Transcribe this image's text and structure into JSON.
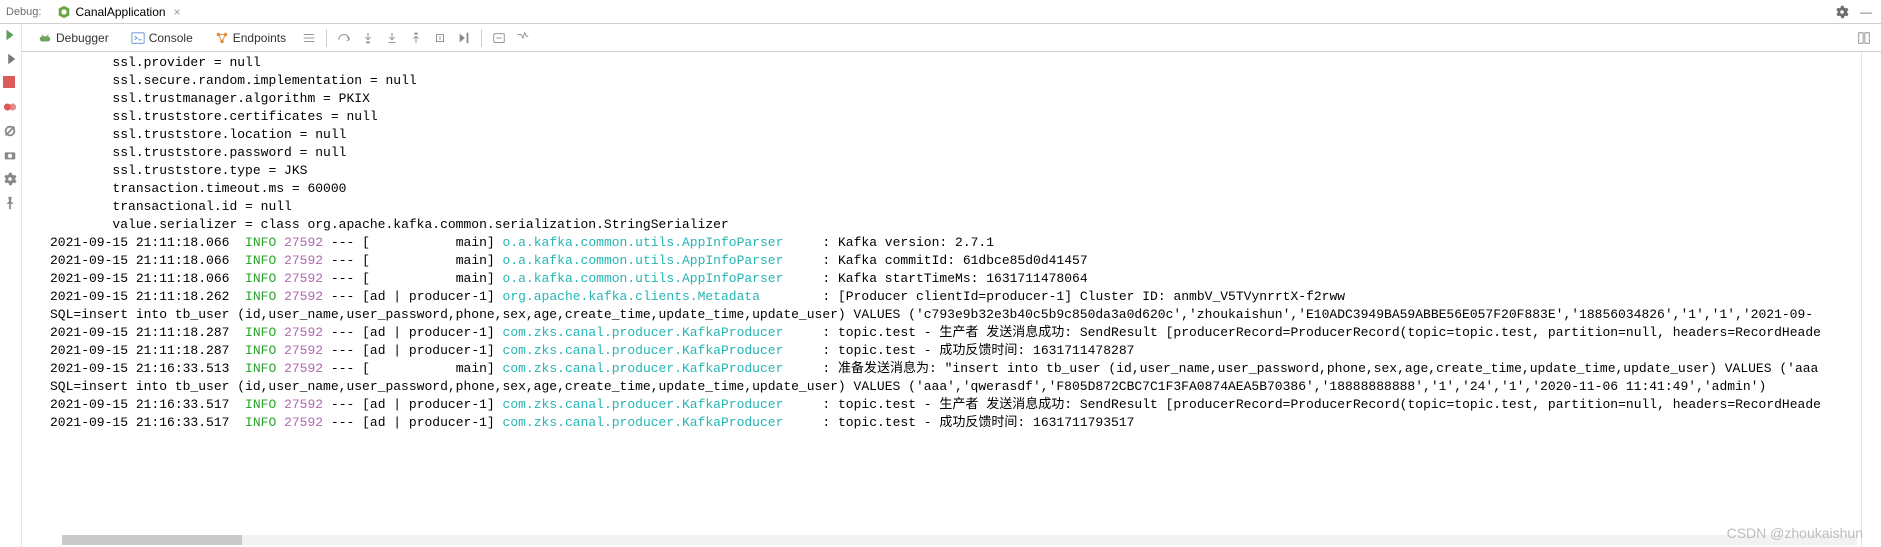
{
  "header": {
    "debugLabel": "Debug:",
    "tabTitle": "CanalApplication"
  },
  "toolbar": {
    "debugger": "Debugger",
    "console": "Console",
    "endpoints": "Endpoints"
  },
  "config_lines": [
    "\tssl.provider = null",
    "\tssl.secure.random.implementation = null",
    "\tssl.trustmanager.algorithm = PKIX",
    "\tssl.truststore.certificates = null",
    "\tssl.truststore.location = null",
    "\tssl.truststore.password = null",
    "\tssl.truststore.type = JKS",
    "\ttransaction.timeout.ms = 60000",
    "\ttransactional.id = null",
    "\tvalue.serializer = class org.apache.kafka.common.serialization.StringSerializer",
    ""
  ],
  "log_lines": [
    {
      "ts": "2021-09-15 21:11:18.066",
      "level": "INFO",
      "pid": "27592",
      "sep": " --- [           main] ",
      "logger": "o.a.kafka.common.utils.AppInfoParser    ",
      "msg": " : Kafka version: 2.7.1"
    },
    {
      "ts": "2021-09-15 21:11:18.066",
      "level": "INFO",
      "pid": "27592",
      "sep": " --- [           main] ",
      "logger": "o.a.kafka.common.utils.AppInfoParser    ",
      "msg": " : Kafka commitId: 61dbce85d0d41457"
    },
    {
      "ts": "2021-09-15 21:11:18.066",
      "level": "INFO",
      "pid": "27592",
      "sep": " --- [           main] ",
      "logger": "o.a.kafka.common.utils.AppInfoParser    ",
      "msg": " : Kafka startTimeMs: 1631711478064"
    },
    {
      "ts": "2021-09-15 21:11:18.262",
      "level": "INFO",
      "pid": "27592",
      "sep": " --- [ad | producer-1] ",
      "logger": "org.apache.kafka.clients.Metadata       ",
      "msg": " : [Producer clientId=producer-1] Cluster ID: anmbV_V5TVynrrtX-f2rww"
    },
    {
      "raw": "SQL=insert into tb_user (id,user_name,user_password,phone,sex,age,create_time,update_time,update_user) VALUES ('c793e9b32e3b40c5b9c850da3a0d620c','zhoukaishun','E10ADC3949BA59ABBE56E057F20F883E','18856034826','1','1','2021-09-"
    },
    {
      "ts": "2021-09-15 21:11:18.287",
      "level": "INFO",
      "pid": "27592",
      "sep": " --- [ad | producer-1] ",
      "logger": "com.zks.canal.producer.KafkaProducer    ",
      "msg": " : topic.test - 生产者 发送消息成功: SendResult [producerRecord=ProducerRecord(topic=topic.test, partition=null, headers=RecordHeade"
    },
    {
      "ts": "2021-09-15 21:11:18.287",
      "level": "INFO",
      "pid": "27592",
      "sep": " --- [ad | producer-1] ",
      "logger": "com.zks.canal.producer.KafkaProducer    ",
      "msg": " : topic.test - 成功反馈时间: 1631711478287"
    },
    {
      "ts": "2021-09-15 21:16:33.513",
      "level": "INFO",
      "pid": "27592",
      "sep": " --- [           main] ",
      "logger": "com.zks.canal.producer.KafkaProducer    ",
      "msg": " : 准备发送消息为: \"insert into tb_user (id,user_name,user_password,phone,sex,age,create_time,update_time,update_user) VALUES ('aaa"
    },
    {
      "raw": "SQL=insert into tb_user (id,user_name,user_password,phone,sex,age,create_time,update_time,update_user) VALUES ('aaa','qwerasdf','F805D872CBC7C1F3FA0874AEA5B70386','18888888888','1','24','1','2020-11-06 11:41:49','admin')"
    },
    {
      "ts": "2021-09-15 21:16:33.517",
      "level": "INFO",
      "pid": "27592",
      "sep": " --- [ad | producer-1] ",
      "logger": "com.zks.canal.producer.KafkaProducer    ",
      "msg": " : topic.test - 生产者 发送消息成功: SendResult [producerRecord=ProducerRecord(topic=topic.test, partition=null, headers=RecordHeade"
    },
    {
      "ts": "2021-09-15 21:16:33.517",
      "level": "INFO",
      "pid": "27592",
      "sep": " --- [ad | producer-1] ",
      "logger": "com.zks.canal.producer.KafkaProducer    ",
      "msg": " : topic.test - 成功反馈时间: 1631711793517"
    }
  ],
  "watermark": "CSDN @zhoukaishun"
}
